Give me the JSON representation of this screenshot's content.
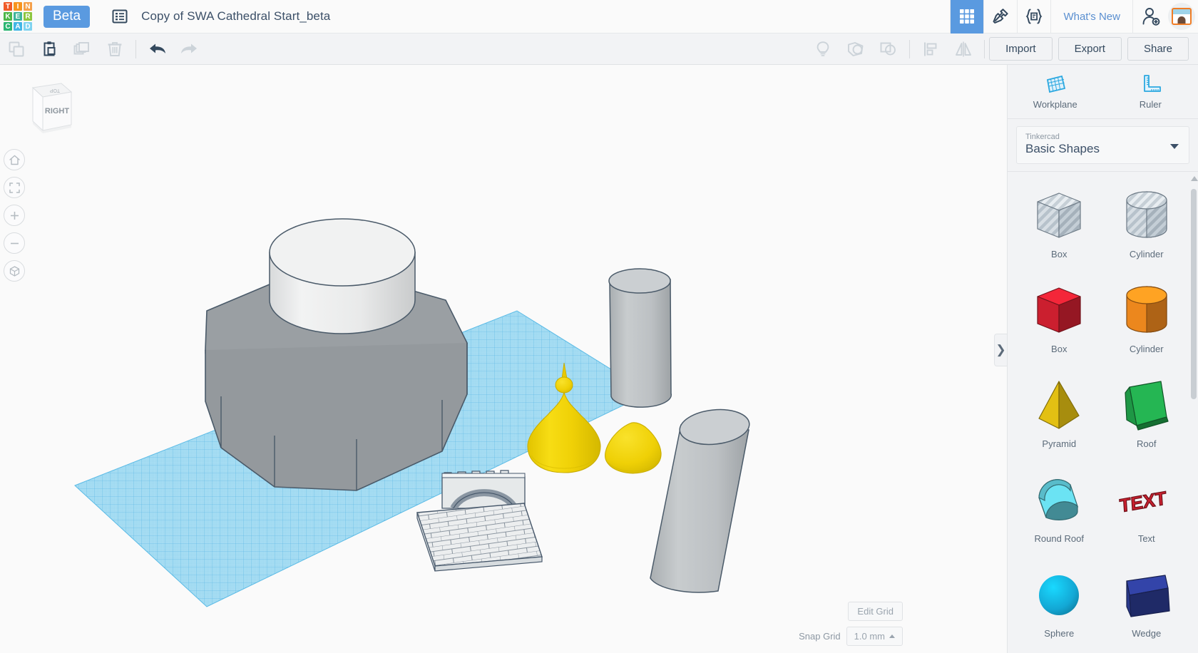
{
  "app": {
    "logo_letters": [
      {
        "ch": "T",
        "color": "#f05a28"
      },
      {
        "ch": "I",
        "color": "#f7941e"
      },
      {
        "ch": "N",
        "color": "#f5a04a"
      },
      {
        "ch": "K",
        "color": "#4cb648"
      },
      {
        "ch": "E",
        "color": "#3db49a"
      },
      {
        "ch": "R",
        "color": "#8dc63f"
      },
      {
        "ch": "C",
        "color": "#2bb673"
      },
      {
        "ch": "A",
        "color": "#41b6e6"
      },
      {
        "ch": "D",
        "color": "#7fd3f0"
      }
    ],
    "beta_label": "Beta",
    "doc_icon": "design-list-icon",
    "document_title": "Copy of SWA Cathedral Start_beta",
    "accent_blue": "#5a9ae0",
    "text_color": "#34495e"
  },
  "topbar": {
    "tools": [
      {
        "name": "grid-3d-view-icon",
        "icon": "grid",
        "active": true
      },
      {
        "name": "codeblocks-icon",
        "icon": "hammer",
        "active": false
      },
      {
        "name": "blocks-icon",
        "icon": "braces",
        "active": false
      }
    ],
    "whats_new_label": "What's New",
    "add_user_icon": "add-person-icon",
    "avatar_icon": "user-avatar"
  },
  "toolbar2": {
    "left_icons": [
      {
        "name": "copy-button",
        "icon": "copy",
        "disabled": true
      },
      {
        "name": "paste-button",
        "icon": "paste",
        "disabled": false
      },
      {
        "name": "duplicate-button",
        "icon": "duplicate",
        "disabled": true
      },
      {
        "name": "delete-button",
        "icon": "trash",
        "disabled": true
      }
    ],
    "history_icons": [
      {
        "name": "undo-button",
        "icon": "undo",
        "disabled": false
      },
      {
        "name": "redo-button",
        "icon": "redo",
        "disabled": true
      }
    ],
    "right_icons": [
      {
        "name": "light-bulb-button",
        "icon": "bulb",
        "disabled": true
      },
      {
        "name": "group-button",
        "icon": "group",
        "disabled": true
      },
      {
        "name": "ungroup-button",
        "icon": "ungroup",
        "disabled": true
      },
      {
        "name": "align-button",
        "icon": "align",
        "disabled": true
      },
      {
        "name": "mirror-button",
        "icon": "mirror",
        "disabled": true
      }
    ],
    "import_label": "Import",
    "export_label": "Export",
    "share_label": "Share"
  },
  "canvas": {
    "view_cube": {
      "front_face_label": "RIGHT",
      "top_face_label": "TOP"
    },
    "nav_buttons": [
      {
        "name": "home-view-button",
        "icon": "home"
      },
      {
        "name": "fit-to-view-button",
        "icon": "fit"
      },
      {
        "name": "zoom-in-button",
        "icon": "plus"
      },
      {
        "name": "zoom-out-button",
        "icon": "minus"
      },
      {
        "name": "perspective-toggle-button",
        "icon": "cube"
      }
    ],
    "edit_grid_label": "Edit Grid",
    "snap_grid_label": "Snap Grid",
    "snap_grid_value": "1.0 mm",
    "workplane_color": "#9fdaf2",
    "workplane_grid_color": "#39a8dd",
    "objects": [
      {
        "name": "octagonal-prism-base",
        "color": "#9a9fa3"
      },
      {
        "name": "white-cylinder-tower",
        "color": "#ececec"
      },
      {
        "name": "grey-cylinder-tall",
        "color": "#b9bdc0"
      },
      {
        "name": "grey-cylinder-large",
        "color": "#b9bdc0"
      },
      {
        "name": "yellow-onion-dome-with-spire",
        "color": "#f2d300"
      },
      {
        "name": "yellow-onion-dome-small",
        "color": "#f2d300"
      },
      {
        "name": "brick-wall-with-arch",
        "color": "#e9ebec"
      }
    ]
  },
  "right_panel": {
    "tools": [
      {
        "name": "workplane-tool",
        "label": "Workplane",
        "icon": "workplane-icon"
      },
      {
        "name": "ruler-tool",
        "label": "Ruler",
        "icon": "ruler-icon"
      }
    ],
    "library": {
      "source_label": "Tinkercad",
      "selected_label": "Basic Shapes"
    },
    "shapes": [
      {
        "name": "shape-box-hole",
        "label": "Box",
        "kind": "box",
        "color": "#c3ccd3",
        "hole": true
      },
      {
        "name": "shape-cylinder-hole",
        "label": "Cylinder",
        "kind": "cylinder",
        "color": "#c3ccd3",
        "hole": true
      },
      {
        "name": "shape-box-red",
        "label": "Box",
        "kind": "box",
        "color": "#cf2030",
        "hole": false
      },
      {
        "name": "shape-cylinder-orange",
        "label": "Cylinder",
        "kind": "cylinder",
        "color": "#f18a1e",
        "hole": false
      },
      {
        "name": "shape-pyramid",
        "label": "Pyramid",
        "kind": "pyramid",
        "color": "#e8c413",
        "hole": false
      },
      {
        "name": "shape-roof",
        "label": "Roof",
        "kind": "roof",
        "color": "#1f9a46",
        "hole": false
      },
      {
        "name": "shape-round-roof",
        "label": "Round Roof",
        "kind": "roundroof",
        "color": "#5bc0ce",
        "hole": false
      },
      {
        "name": "shape-text",
        "label": "Text",
        "kind": "text",
        "color": "#cf2030",
        "hole": false
      },
      {
        "name": "shape-sphere",
        "label": "Sphere",
        "kind": "sphere",
        "color": "#13a7d4",
        "hole": false
      },
      {
        "name": "shape-wedge",
        "label": "Wedge",
        "kind": "wedge",
        "color": "#2b3a8f",
        "hole": false
      }
    ],
    "collapse_handle": "❯"
  }
}
